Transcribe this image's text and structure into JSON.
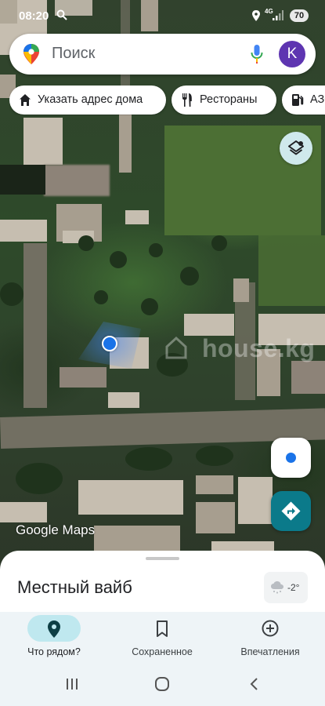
{
  "status_bar": {
    "time": "08:20",
    "network": "4G",
    "battery": "70"
  },
  "search": {
    "placeholder": "Поиск",
    "avatar_letter": "K"
  },
  "chips": [
    {
      "label": "Указать адрес дома",
      "icon": "home-icon"
    },
    {
      "label": "Рестораны",
      "icon": "fork-knife-icon"
    },
    {
      "label": "АЗС",
      "icon": "gas-station-icon"
    }
  ],
  "map": {
    "watermark": "house.kg",
    "attribution": "Google Maps"
  },
  "sheet": {
    "title": "Местный вайб",
    "weather_temp": "-2°"
  },
  "bottom_nav": [
    {
      "label": "Что рядом?",
      "icon": "location-pin-icon",
      "active": true
    },
    {
      "label": "Сохраненное",
      "icon": "bookmark-icon",
      "active": false
    },
    {
      "label": "Впечатления",
      "icon": "add-circle-icon",
      "active": false
    }
  ],
  "colors": {
    "accent": "#0b7a8a",
    "active_pill": "#bfe8ef",
    "avatar": "#5e35b1",
    "location_blue": "#1a73e8"
  }
}
